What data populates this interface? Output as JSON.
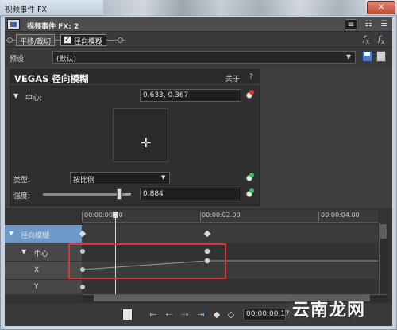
{
  "window": {
    "title": "视频事件 FX",
    "close_glyph": "✕"
  },
  "header": {
    "title": "视频事件 FX: 2"
  },
  "chain": {
    "tab1": "平移/裁切",
    "tab2": "径向模糊",
    "checked_mark": "✓"
  },
  "preset": {
    "label": "预设:",
    "value": "(默认)"
  },
  "plugin": {
    "title": "VEGAS 径向模糊",
    "about": "关于",
    "help": "?",
    "center_label": "中心:",
    "center_value": "0.633, 0.367",
    "type_label": "类型:",
    "type_value": "按比例",
    "strength_label": "强度:",
    "strength_value": "0.884",
    "strength_level": 0.884
  },
  "timeline": {
    "times": [
      "00:00:00.00",
      "00:00:02.00",
      "00:00:04.00"
    ],
    "tracks": {
      "main": "径向模糊",
      "center": "中心",
      "x": "X",
      "y": "Y"
    }
  },
  "bottom": {
    "time": "00:00:00.17"
  },
  "watermark": "云南龙网",
  "colors": {
    "accent_blue": "#69b5e6",
    "highlight_red": "#d13a3a",
    "track_blue": "#6d98c8"
  }
}
